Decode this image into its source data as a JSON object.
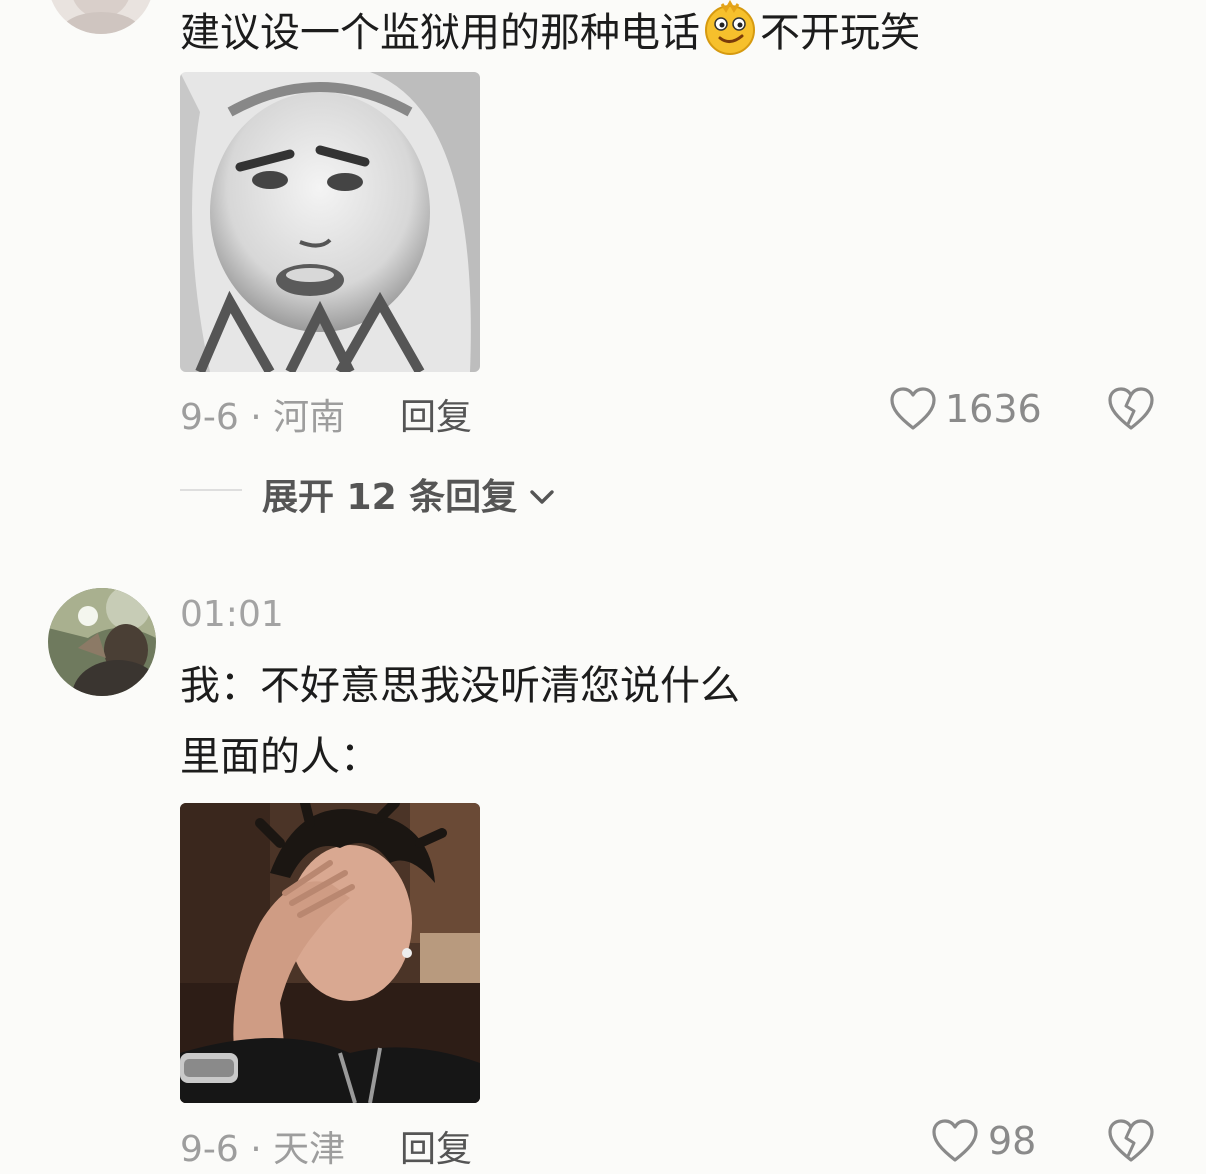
{
  "comment1": {
    "text_before_emoji": "建议设一个监狱用的那种电话",
    "emoji": "smirk-emoji",
    "text_after_emoji": "不开玩笑",
    "meta": "9-6 · 河南",
    "reply_label": "回复",
    "like_count": "1636",
    "expand_label": "展开 12 条回复"
  },
  "comment2": {
    "timestamp": "01:01",
    "line1": "我：不好意思我没听清您说什么",
    "line2": "里面的人：",
    "meta": "9-6 · 天津",
    "reply_label": "回复",
    "like_count": "98"
  },
  "colors": {
    "background": "#fbfbf9",
    "text": "#1c1c1c",
    "muted": "#9d9d9d"
  }
}
